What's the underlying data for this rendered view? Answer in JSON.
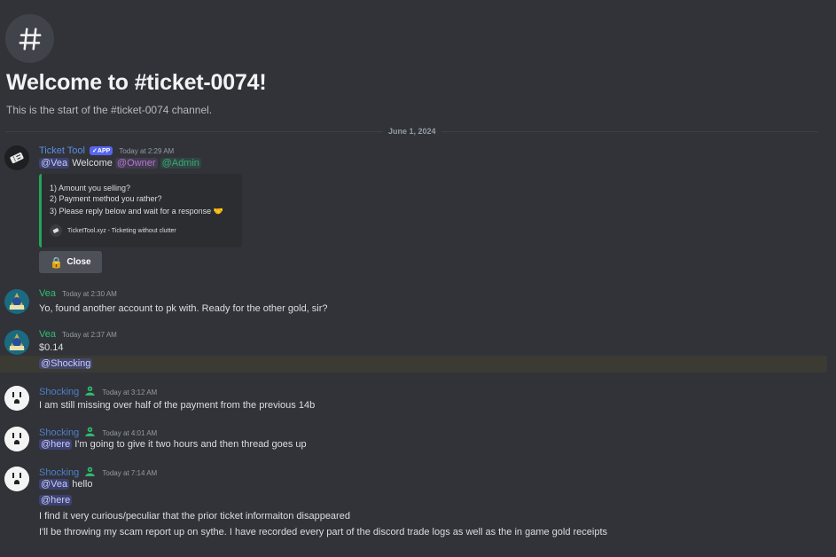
{
  "channel": {
    "hash_symbol": "#",
    "welcome_title": "Welcome to #ticket-0074!",
    "welcome_subtitle": "This is the start of the #ticket-0074 channel."
  },
  "date_divider": "June 1, 2024",
  "messages": [
    {
      "username": "Ticket Tool",
      "badge": "APP",
      "timestamp": "Today at 2:29 AM",
      "mention_user": "@Vea",
      "welcome_text": "Welcome",
      "mention_owner": "@Owner",
      "mention_admin": "@Admin",
      "embed": {
        "lines": [
          "1) Amount you selling?",
          "2) Payment method you rather?",
          "3) Please reply below and wait for a response"
        ],
        "line3_emoji": "🤝",
        "footer": "TicketTool.xyz - Ticketing without clutter"
      },
      "button": {
        "emoji": "🔒",
        "label": "Close"
      }
    },
    {
      "username": "Vea",
      "timestamp": "Today at 2:30 AM",
      "text": "Yo, found another account to pk with. Ready for the other gold, sir?"
    },
    {
      "username": "Vea",
      "timestamp": "Today at 2:37 AM",
      "text": "$0.14",
      "mention": "@Shocking"
    },
    {
      "username": "Shocking",
      "timestamp": "Today at 3:12 AM",
      "text": "I am still missing over half of the payment from the previous 14b"
    },
    {
      "username": "Shocking",
      "timestamp": "Today at 4:01 AM",
      "mention": "@here",
      "text": "I'm going to give it two hours and then thread goes up"
    },
    {
      "username": "Shocking",
      "timestamp": "Today at 7:14 AM",
      "mention": "@Vea",
      "text": "hello",
      "mention2": "@here",
      "line3": "I find it very curious/peculiar that the prior ticket informaiton disappeared",
      "line4": "I'll be throwing my scam report up on sythe.  I have recorded every part of the discord trade logs as well as the in game gold receipts"
    }
  ],
  "colors": {
    "background": "#313338",
    "embed_accent": "#23a559",
    "mention_highlight_row": "#3b3a33"
  }
}
